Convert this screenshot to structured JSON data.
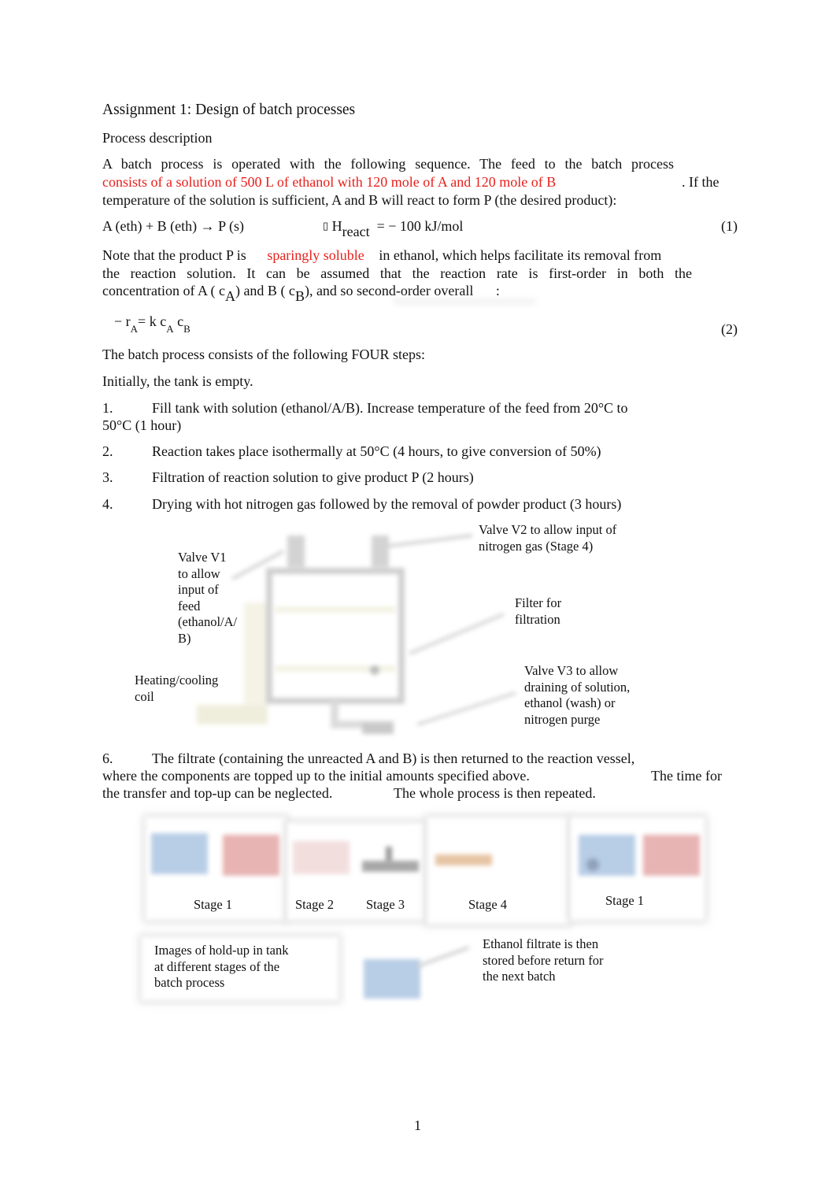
{
  "title": "Assignment 1: Design of batch processes",
  "section": "Process description",
  "intro": {
    "line1": "A batch process is operated with the following sequence. The feed to the batch process",
    "line2_red": "consists of a solution of 500 L of ethanol with 120 mole of A and 120 mole of B",
    "line2_tail": ".   If the",
    "line3": "temperature of the solution is sufficient, A and B will react to form P (the desired product):"
  },
  "equation1": {
    "lhs": "A (eth) + B (eth) → P (s)",
    "delta_symbol": "▯",
    "h": "H",
    "h_sub": "react",
    "rhs": "= − 100 kJ/mol",
    "number": "(1)"
  },
  "note": {
    "pre": "Note that the product P is",
    "red": "sparingly soluble",
    "post": "in ethanol, which helps facilitate its removal from",
    "line2": "the reaction solution.      It can be assumed that the reaction rate is first-order in both the",
    "line3_a": "concentration of A (  c",
    "line3_sub_a": "A",
    "line3_b": ") and B ( c",
    "line3_sub_b": "B",
    "line3_c": "), and so second-order overall",
    "line3_colon": ":"
  },
  "equation2": {
    "minus_r": "− r",
    "sub_a": "A",
    "eq_k": "= k  c",
    "sub_a2": "A",
    "c": " c",
    "sub_b": "B",
    "number": "(2)"
  },
  "steps_intro": "The batch process consists of the following FOUR steps:",
  "initially": "Initially, the tank is empty.",
  "steps": [
    {
      "num": "1.",
      "text": "Fill tank with solution (ethanol/A/B).     Increase temperature of the feed from 20°C to",
      "cont": "50°C (1 hour)"
    },
    {
      "num": "2.",
      "text": "Reaction takes place isothermally at 50°C (4 hours, to give conversion of 50%)"
    },
    {
      "num": "3.",
      "text": "Filtration of reaction solution to give product P (2 hours)"
    },
    {
      "num": "4.",
      "text": "Drying with hot nitrogen gas followed by the removal of powder product (3 hours)"
    }
  ],
  "diagram": {
    "v1": [
      "Valve V1",
      "to allow",
      "input of",
      "feed",
      "(ethanol/A/",
      "B)"
    ],
    "coil": [
      "Heating/cooling",
      "coil"
    ],
    "v2": [
      "Valve V2 to allow input of",
      "nitrogen gas (Stage 4)"
    ],
    "filter": [
      "Filter for",
      "filtration"
    ],
    "v3": [
      "Valve V3 to allow",
      "draining of solution,",
      "ethanol (wash) or",
      "nitrogen purge"
    ]
  },
  "step6": {
    "num": "6.",
    "line1": "The filtrate (containing the unreacted A and B) is then returned to the reaction vessel,",
    "line2a": "where the components are topped up to the initial amounts specified above.",
    "line2b": "The time for",
    "line3a": "the transfer and top-up can be neglected.",
    "line3b": "The whole process is then repeated."
  },
  "stages": {
    "labels": [
      "Stage 1",
      "Stage 2",
      "Stage 3",
      "Stage 4",
      "Stage 1"
    ],
    "colors": {
      "blue": "#b8cde6",
      "red": "#e8b3b3",
      "pink": "#f3dede",
      "orange": "#e6c4a4",
      "grey": "#a8a8a8"
    },
    "caption": [
      "Images of hold-up in tank",
      "at different stages of the",
      "batch process"
    ],
    "filtrate_note": [
      "Ethanol filtrate is then",
      "stored before return for",
      "the next batch"
    ]
  },
  "page_number": "1"
}
